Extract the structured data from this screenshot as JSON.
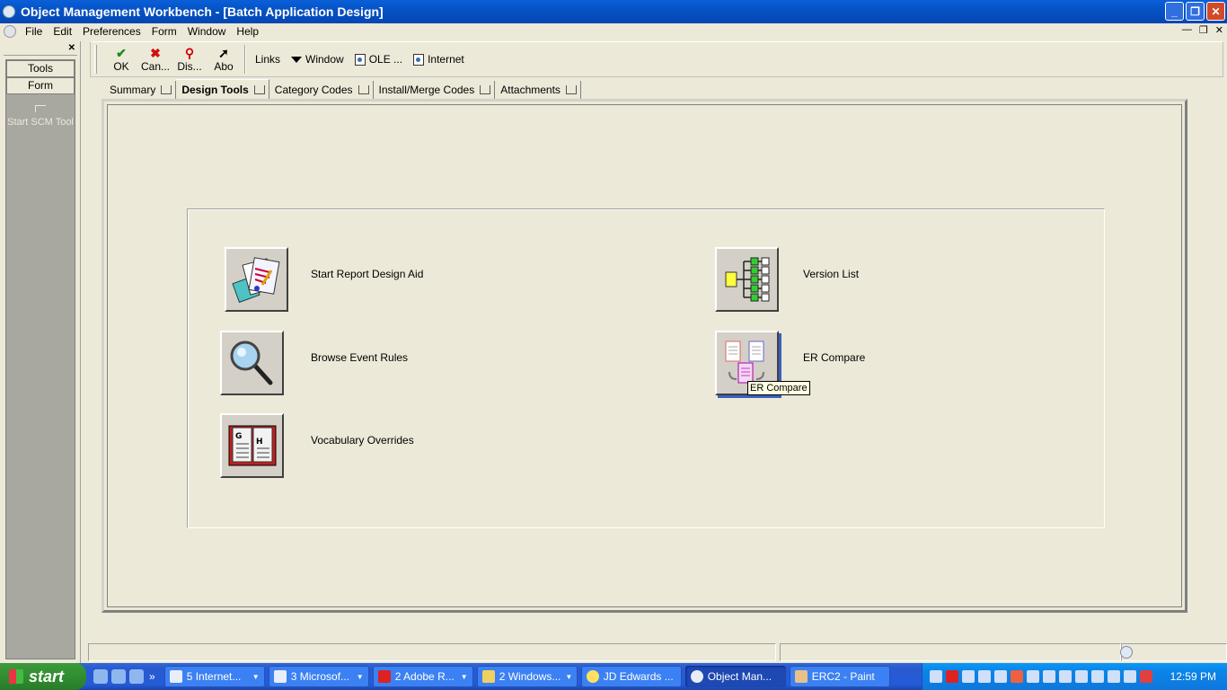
{
  "window": {
    "title": "Object Management Workbench - [Batch Application Design]"
  },
  "menu": {
    "items": [
      "File",
      "Edit",
      "Preferences",
      "Form",
      "Window",
      "Help"
    ]
  },
  "left_pane": {
    "tools_label": "Tools",
    "form_label": "Form",
    "item_label": "Start SCM Tool"
  },
  "toolbar": {
    "ok": "OK",
    "cancel": "Can...",
    "display": "Dis...",
    "about": "Abo",
    "links": "Links",
    "window": "Window",
    "ole": "OLE ...",
    "internet": "Internet"
  },
  "tabs": [
    "Summary",
    "Design Tools",
    "Category Codes",
    "Install/Merge Codes",
    "Attachments"
  ],
  "active_tab": "Design Tools",
  "tools": {
    "report_design": "Start Report Design Aid",
    "browse_er": "Browse Event Rules",
    "vocab": "Vocabulary Overrides",
    "version_list": "Version List",
    "er_compare": "ER Compare"
  },
  "tooltip": "ER Compare",
  "taskbar": {
    "start": "start",
    "tasks": [
      "5 Internet...",
      "3 Microsof...",
      "2 Adobe R...",
      "2 Windows...",
      "JD Edwards ...",
      "Object Man...",
      "ERC2 - Paint"
    ],
    "active_task": "Object Man...",
    "clock": "12:59 PM"
  }
}
